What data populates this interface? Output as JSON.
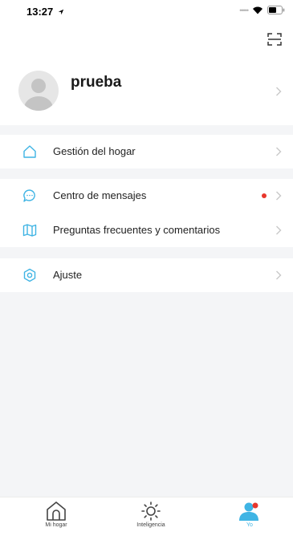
{
  "status_bar": {
    "time": "13:27"
  },
  "profile": {
    "name": "prueba"
  },
  "menu": [
    {
      "id": "home",
      "label": "Gestión del hogar"
    },
    {
      "id": "messages",
      "label": "Centro de mensajes"
    },
    {
      "id": "faq",
      "label": "Preguntas frecuentes y comentarios"
    },
    {
      "id": "settings",
      "label": "Ajuste"
    }
  ],
  "tabbar": {
    "tabs": [
      {
        "label": "Mi hogar"
      },
      {
        "label": "Inteligencia"
      },
      {
        "label": "Yo"
      }
    ]
  },
  "colors": {
    "accent": "#3fb4e4",
    "notification_dot": "#e8362c",
    "background": "#f4f5f7"
  },
  "icons": [
    "location-arrow-icon",
    "wifi-icon",
    "battery-icon",
    "scan-icon",
    "house-icon",
    "chat-icon",
    "book-icon",
    "gear-hexagon-icon",
    "chevron-right-icon",
    "sun-icon",
    "person-icon"
  ]
}
